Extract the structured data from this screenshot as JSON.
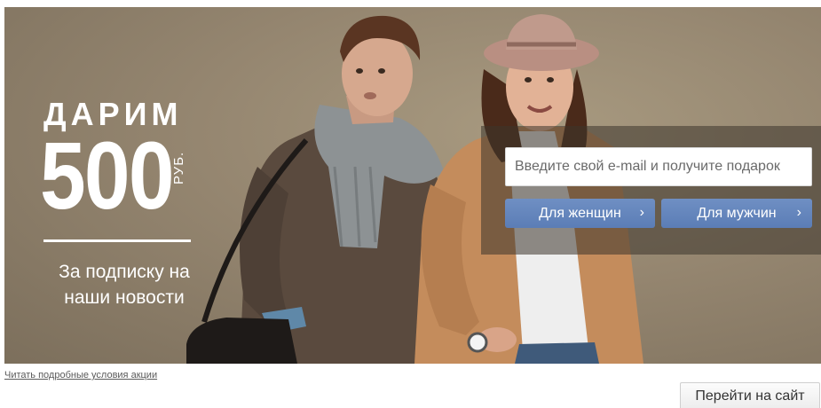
{
  "banner": {
    "headline": "ДАРИМ",
    "amount": "500",
    "currency": "РУБ.",
    "subline_1": "За подписку на",
    "subline_2": "наши новости"
  },
  "form": {
    "email_placeholder": "Введите свой e-mail и получите подарок",
    "women_button": "Для женщин",
    "men_button": "Для мужчин",
    "chevron": "›"
  },
  "footer": {
    "terms_link": "Читать подробные условия акции",
    "site_button": "Перейти на сайт"
  },
  "colors": {
    "banner_bg": "#958670",
    "button_blue": "#5b7db6",
    "overlay": "#3c342c"
  }
}
